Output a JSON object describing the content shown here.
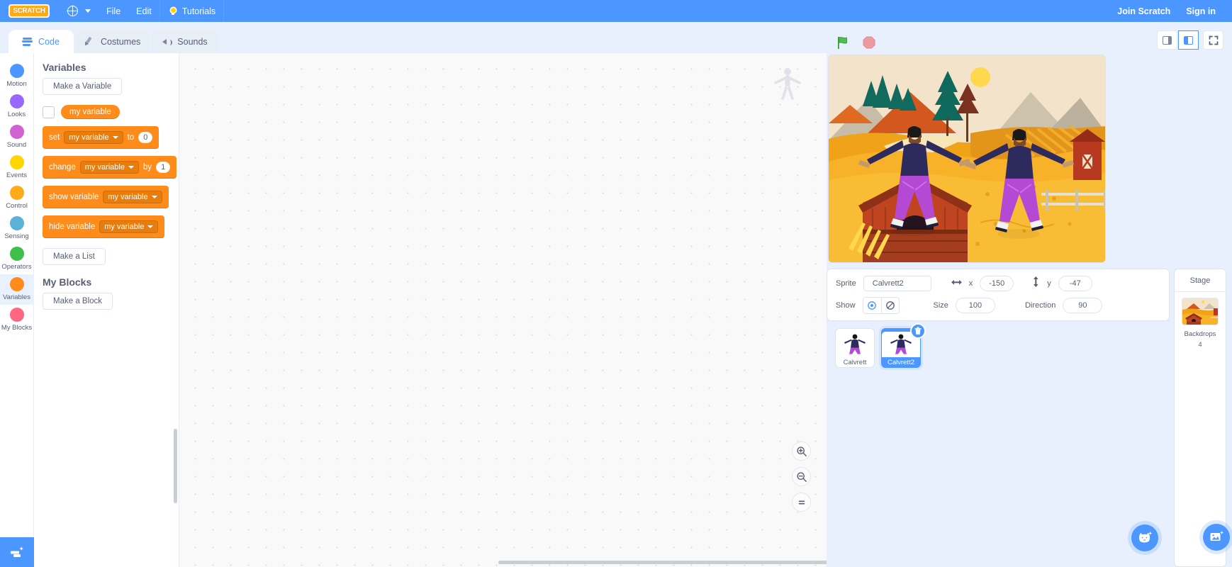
{
  "menubar": {
    "logo_text": "SCRATCH",
    "language_icon": "globe-icon",
    "items": [
      {
        "label": "File"
      },
      {
        "label": "Edit"
      }
    ],
    "tutorials": {
      "label": "Tutorials",
      "icon": "lightbulb-icon"
    },
    "join": "Join Scratch",
    "signin": "Sign in"
  },
  "tabs": [
    {
      "label": "Code",
      "icon": "code-icon",
      "active": true
    },
    {
      "label": "Costumes",
      "icon": "brush-icon",
      "active": false
    },
    {
      "label": "Sounds",
      "icon": "speaker-icon",
      "active": false
    }
  ],
  "stage_controls": {
    "green_flag": "green-flag-icon",
    "stop": "stop-icon",
    "small_stage": "small-stage-icon",
    "large_stage": "large-stage-icon",
    "fullscreen": "fullscreen-icon"
  },
  "categories": [
    {
      "label": "Motion",
      "color": "#4c97ff",
      "selected": false
    },
    {
      "label": "Looks",
      "color": "#9966ff",
      "selected": false
    },
    {
      "label": "Sound",
      "color": "#cf63cf",
      "selected": false
    },
    {
      "label": "Events",
      "color": "#ffd500",
      "selected": false
    },
    {
      "label": "Control",
      "color": "#ffab19",
      "selected": false
    },
    {
      "label": "Sensing",
      "color": "#5cb1d6",
      "selected": false
    },
    {
      "label": "Operators",
      "color": "#40bf4a",
      "selected": false
    },
    {
      "label": "Variables",
      "color": "#ff8c1a",
      "selected": true
    },
    {
      "label": "My Blocks",
      "color": "#ff6680",
      "selected": false
    }
  ],
  "extension_button": {
    "icon": "add-extension-icon"
  },
  "palette": {
    "heading_variables": "Variables",
    "make_variable": "Make a Variable",
    "variable_name": "my variable",
    "blocks": [
      {
        "id": "set",
        "prefix": "set",
        "dropdown": "my variable",
        "mid": "to",
        "value": "0"
      },
      {
        "id": "change",
        "prefix": "change",
        "dropdown": "my variable",
        "mid": "by",
        "value": "1"
      },
      {
        "id": "show",
        "prefix": "show variable",
        "dropdown": "my variable",
        "mid": "",
        "value": ""
      },
      {
        "id": "hide",
        "prefix": "hide variable",
        "dropdown": "my variable",
        "mid": "",
        "value": ""
      }
    ],
    "make_list": "Make a List",
    "heading_myblocks": "My Blocks",
    "make_block": "Make a Block",
    "block_color": "#ff8c1a"
  },
  "canvas": {
    "zoom_in": "zoom-in-icon",
    "zoom_out": "zoom-out-icon",
    "zoom_reset": "zoom-reset-icon"
  },
  "sprite_info": {
    "sprite_label": "Sprite",
    "sprite_name": "Calvrett2",
    "x_label": "x",
    "x_value": "-150",
    "y_label": "y",
    "y_value": "-47",
    "show_label": "Show",
    "size_label": "Size",
    "size_value": "100",
    "direction_label": "Direction",
    "direction_value": "90"
  },
  "sprites": [
    {
      "name": "Calvrett",
      "selected": false
    },
    {
      "name": "Calvrett2",
      "selected": true
    }
  ],
  "sprite_actions": {
    "delete": "delete-icon",
    "add_sprite": "add-sprite-cat-icon",
    "add_backdrop": "add-backdrop-image-icon"
  },
  "stage_column": {
    "title": "Stage",
    "backdrops_label": "Backdrops",
    "backdrops_count": "4"
  },
  "theme": {
    "brand_blue": "#4c97ff",
    "panel_bg": "#e8f0fe",
    "variables_orange": "#ff8c1a",
    "text_grey": "#575e75"
  }
}
